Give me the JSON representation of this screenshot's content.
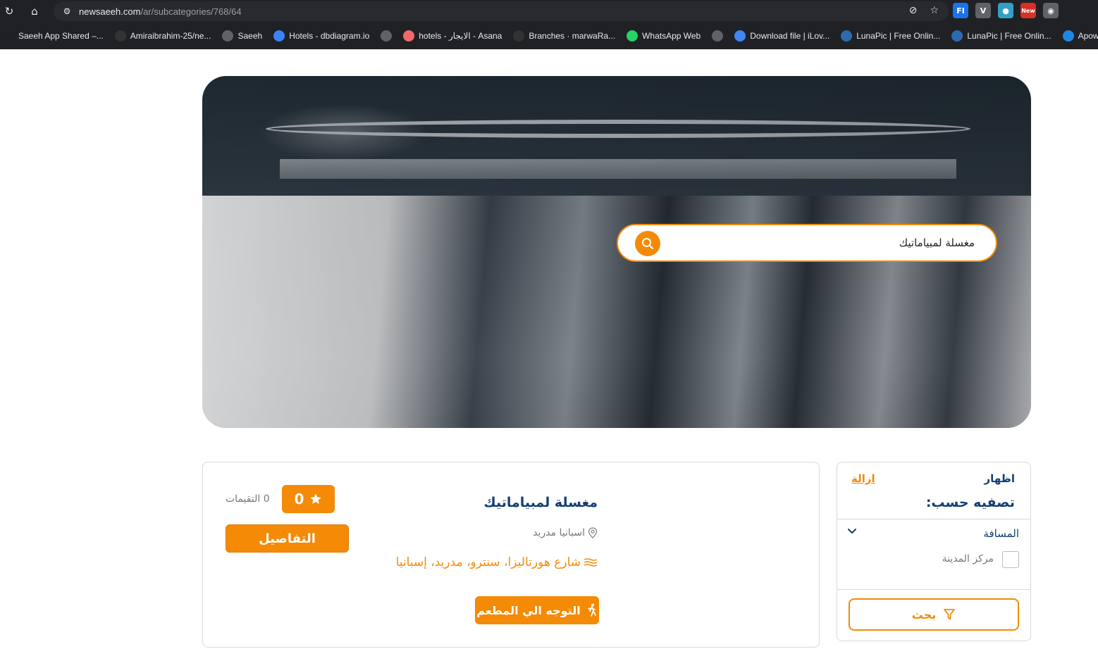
{
  "browser": {
    "url_host": "newsaeeh.com",
    "url_path": "/ar/subcategories/768/64",
    "extensions": [
      {
        "name": "fi-extension-icon",
        "label": "FI",
        "color": "#1a73e8"
      },
      {
        "name": "v-extension-icon",
        "label": "V",
        "color": "#5f6368"
      },
      {
        "name": "snip-extension-icon",
        "label": "●",
        "color": "#34a0c8"
      },
      {
        "name": "new-extension-icon",
        "label": "New",
        "color": "#d93025"
      },
      {
        "name": "camera-extension-icon",
        "label": "◉",
        "color": "#5f6368"
      }
    ],
    "bookmarks": [
      {
        "label": "Saeeh App Shared –...",
        "icon_color": "#202124"
      },
      {
        "label": "Amiraibrahim-25/ne...",
        "icon_color": "#333333"
      },
      {
        "label": "Saeeh",
        "icon_color": "#5f6368"
      },
      {
        "label": "Hotels - dbdiagram.io",
        "icon_color": "#3b82f6"
      },
      {
        "label": "",
        "icon_color": "#5f6368"
      },
      {
        "label": "hotels - الايجار - Asana",
        "icon_color": "#f06a6a"
      },
      {
        "label": "Branches · marwaRa...",
        "icon_color": "#333333"
      },
      {
        "label": "WhatsApp Web",
        "icon_color": "#25d366"
      },
      {
        "label": "",
        "icon_color": "#5f6368"
      },
      {
        "label": "Download file | iLov...",
        "icon_color": "#4285f4"
      },
      {
        "label": "LunaPic | Free Onlin...",
        "icon_color": "#2b6cb0"
      },
      {
        "label": "LunaPic | Free Onlin...",
        "icon_color": "#2b6cb0"
      },
      {
        "label": "Apowersoft",
        "icon_color": "#1e88e5"
      }
    ]
  },
  "hero": {
    "search_value": "مغسلة لمبياماتيك"
  },
  "result": {
    "title": "مغسلة لمبياماتيك",
    "location": "اسبانيا مدريد",
    "address": "شارع هورتاليزا، سنترو، مدريد، إسبانيا",
    "rating": "0",
    "ratings_count": "0 التقيمات",
    "details_label": "التفاصيل",
    "directions_label": "التوجه الي المطعم"
  },
  "filter": {
    "show_label": "اظهار",
    "clear_label": "ازالة",
    "title": "تصفيه حسب:",
    "distance_label": "المسافة",
    "option_label": "مركز المدينة",
    "option_checked": false,
    "search_label": "بحث"
  },
  "colors": {
    "accent": "#f58a07",
    "primary_text": "#123f74"
  }
}
